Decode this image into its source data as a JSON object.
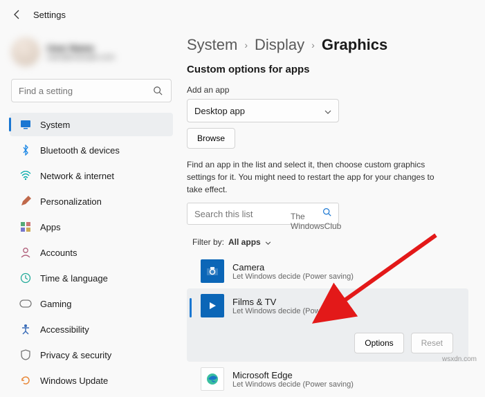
{
  "top": {
    "title": "Settings"
  },
  "profile": {
    "name": "User Name",
    "email": "user@example.com"
  },
  "search": {
    "placeholder": "Find a setting"
  },
  "nav": {
    "items": [
      {
        "label": "System"
      },
      {
        "label": "Bluetooth & devices"
      },
      {
        "label": "Network & internet"
      },
      {
        "label": "Personalization"
      },
      {
        "label": "Apps"
      },
      {
        "label": "Accounts"
      },
      {
        "label": "Time & language"
      },
      {
        "label": "Gaming"
      },
      {
        "label": "Accessibility"
      },
      {
        "label": "Privacy & security"
      },
      {
        "label": "Windows Update"
      }
    ]
  },
  "crumbs": {
    "a": "System",
    "b": "Display",
    "c": "Graphics"
  },
  "main": {
    "heading": "Custom options for apps",
    "add_label": "Add an app",
    "combo_value": "Desktop app",
    "browse": "Browse",
    "desc": "Find an app in the list and select it, then choose custom graphics settings for it. You might need to restart the app for your changes to take effect.",
    "list_search_placeholder": "Search this list",
    "filter_prefix": "Filter by:",
    "filter_value": "All apps",
    "options_btn": "Options",
    "reset_btn": "Reset"
  },
  "apps": [
    {
      "name": "Camera",
      "sub": "Let Windows decide (Power saving)"
    },
    {
      "name": "Films & TV",
      "sub": "Let Windows decide (Power saving)"
    },
    {
      "name": "Microsoft Edge",
      "sub": "Let Windows decide (Power saving)"
    }
  ],
  "watermark": {
    "line1": "The",
    "line2": "WindowsClub"
  },
  "footer": "wsxdn.com"
}
